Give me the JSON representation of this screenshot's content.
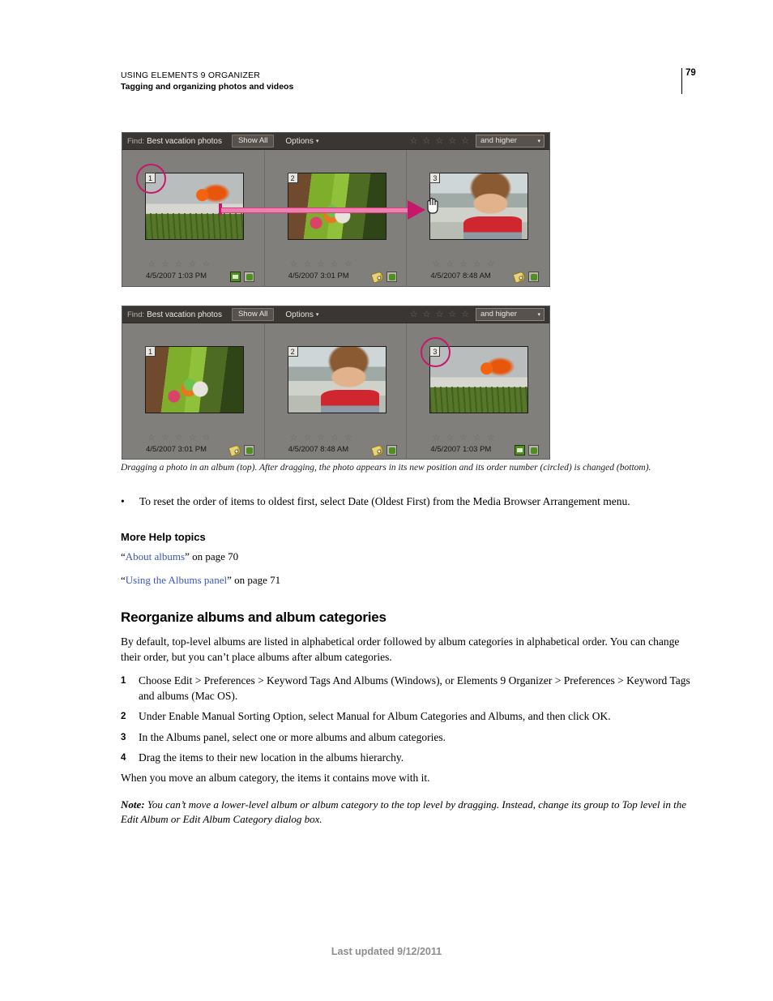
{
  "header": {
    "line1": "USING ELEMENTS 9 ORGANIZER",
    "line2": "Tagging and organizing photos and videos",
    "page_number": "79"
  },
  "app_toolbar": {
    "find_label": "Find:",
    "find_value": "Best vacation photos",
    "show_all_label": "Show All",
    "options_label": "Options",
    "caret": "▾",
    "star": "☆",
    "star_count": 5,
    "rating_select_label": "and higher"
  },
  "figures": {
    "top": {
      "items": [
        {
          "order": "1",
          "circled": true,
          "photo": "flower",
          "date": "4/5/2007 1:03 PM",
          "icons": [
            "stack-icon",
            "album-icon"
          ]
        },
        {
          "order": "2",
          "circled": false,
          "photo": "kids",
          "date": "4/5/2007 3:01 PM",
          "icons": [
            "tag-icon",
            "album-icon"
          ]
        },
        {
          "order": "3",
          "circled": false,
          "photo": "girl",
          "date": "4/5/2007 8:48 AM",
          "icons": [
            "tag-icon",
            "album-icon"
          ]
        }
      ]
    },
    "bottom": {
      "items": [
        {
          "order": "1",
          "circled": false,
          "photo": "kids",
          "date": "4/5/2007 3:01 PM",
          "icons": [
            "tag-icon",
            "album-icon"
          ]
        },
        {
          "order": "2",
          "circled": false,
          "photo": "girl",
          "date": "4/5/2007 8:48 AM",
          "icons": [
            "tag-icon",
            "album-icon"
          ]
        },
        {
          "order": "3",
          "circled": true,
          "photo": "flower",
          "date": "4/5/2007 1:03 PM",
          "icons": [
            "stack-icon",
            "album-icon"
          ]
        }
      ]
    },
    "caption": "Dragging a photo in an album (top). After dragging, the photo appears in its new position and its order number (circled) is changed (bottom)."
  },
  "body": {
    "bullet_marker": "•",
    "bullet_text": "To reset the order of items to oldest first, select Date (Oldest First) from the Media Browser Arrangement menu.",
    "more_help_title": "More Help topics",
    "xrefs": [
      {
        "quote_open": "“",
        "link": "About albums",
        "quote_close": "”",
        "suffix": " on page 70"
      },
      {
        "quote_open": "“",
        "link": "Using the Albums panel",
        "quote_close": "”",
        "suffix": " on page 71"
      }
    ],
    "heading": "Reorganize albums and album categories",
    "intro": "By default, top-level albums are listed in alphabetical order followed by album categories in alphabetical order. You can change their order, but you can’t place albums after album categories.",
    "steps": [
      {
        "num": "1",
        "text": "Choose Edit > Preferences > Keyword Tags And Albums (Windows), or Elements 9 Organizer > Preferences > Keyword Tags and albums (Mac OS)."
      },
      {
        "num": "2",
        "text": "Under Enable Manual Sorting Option, select Manual for Album Categories and Albums, and then click OK."
      },
      {
        "num": "3",
        "text": "In the Albums panel, select one or more albums and album categories."
      },
      {
        "num": "4",
        "text": "Drag the items to their new location in the albums hierarchy."
      }
    ],
    "move_note": "When you move an album category, the items it contains move with it.",
    "note_label": "Note:",
    "note_text": " You can’t move a lower-level album or album category to the top level by dragging. Instead, change its group to Top level in the Edit Album or Edit Album Category dialog box."
  },
  "footer": {
    "text": "Last updated 9/12/2011"
  },
  "colors": {
    "link": "#3a57c4",
    "highlight_ring": "#c8176a",
    "drag_arrow": "#ef7fb0",
    "toolbar_bg": "#3a3633",
    "panel_bg": "#817f7c",
    "footer_text": "#8d8d8d"
  }
}
